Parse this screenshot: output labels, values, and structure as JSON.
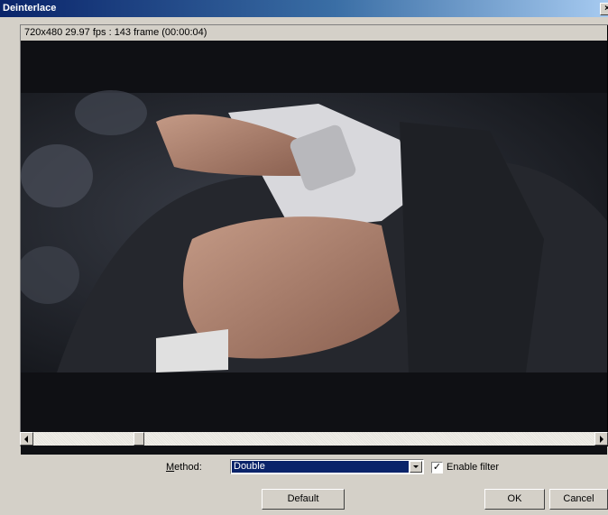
{
  "window": {
    "title": "Deinterlace",
    "close_glyph": "×"
  },
  "preview": {
    "info": "720x480 29.97 fps : 143 frame (00:00:04)"
  },
  "scrollbar": {
    "position": 0.17
  },
  "method": {
    "label_accel": "M",
    "label_rest": "ethod:",
    "value": "Double"
  },
  "enable_filter": {
    "label": "Enable filter",
    "checked": true,
    "check_glyph": "✓"
  },
  "buttons": {
    "default": "Default",
    "ok": "OK",
    "cancel": "Cancel"
  }
}
